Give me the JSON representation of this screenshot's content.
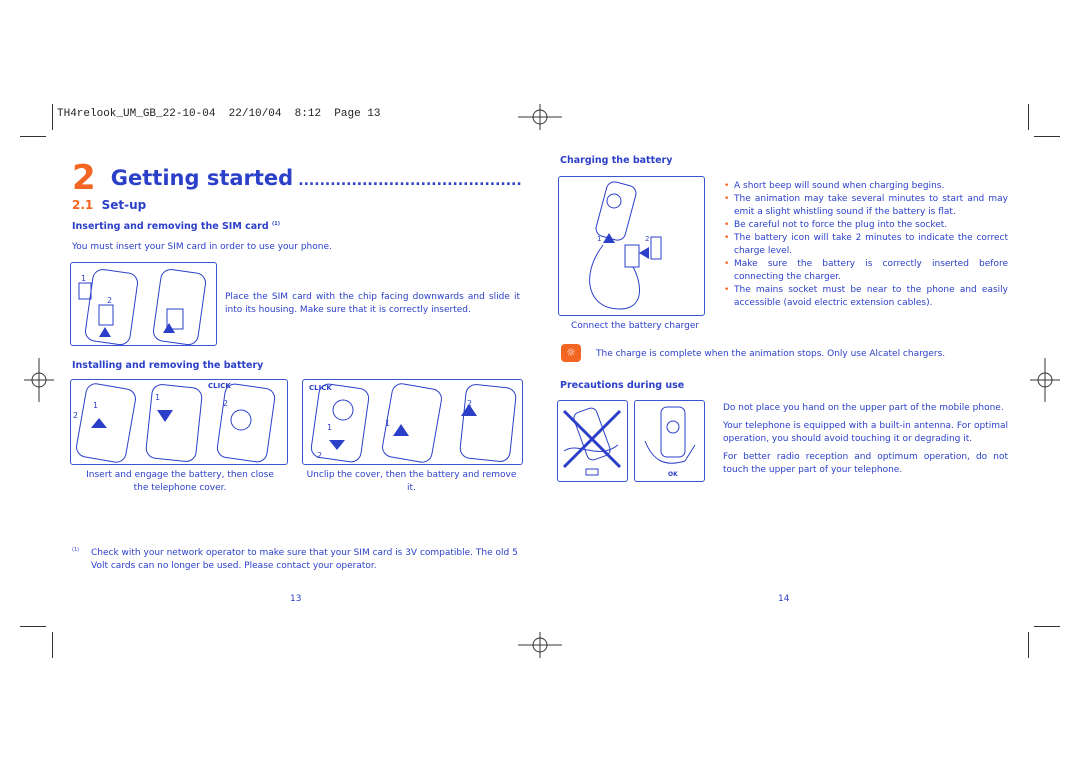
{
  "header": {
    "slug": "TH4relook_UM_GB_22-10-04",
    "date": "22/10/04",
    "time": "8:12",
    "page_label": "Page 13"
  },
  "left": {
    "chapter_number": "2",
    "chapter_title": "Getting started",
    "chapter_leader": "..........................................",
    "section_number": "2.1",
    "section_title": "Set-up",
    "sim_heading": "Inserting and removing the SIM card",
    "sim_footnote_mark": "(1)",
    "sim_intro": "You must insert your SIM card in order to use your phone.",
    "sim_caption": "Place the SIM card with the chip facing downwards and slide it into its housing. Make sure that it is correctly inserted.",
    "battery_heading": "Installing and removing the battery",
    "click_label": "CLICK",
    "insert_caption": "Insert and engage the battery, then close the telephone cover.",
    "unclip_caption": "Unclip the cover, then the battery and remove it.",
    "footnote_mark": "(1)",
    "footnote": "Check with your network operator to make sure that your SIM card is 3V compatible. The old 5 Volt cards can no longer be used. Please contact your operator.",
    "page_number": "13"
  },
  "right": {
    "charging_heading": "Charging the battery",
    "charger_caption": "Connect the battery charger",
    "bullets": [
      "A short beep will sound when charging begins.",
      "The animation may take several minutes to start and may emit a slight whistling sound if the battery is flat.",
      "Be careful not to force the plug into the socket.",
      "The battery icon will take 2 minutes to indicate the correct charge level.",
      "Make sure the battery is correctly inserted before connecting the charger.",
      "The mains socket must be near to the phone and easily accessible (avoid electric extension cables)."
    ],
    "tip": "The charge is complete when the animation stops. Only use Alcatel chargers.",
    "precautions_heading": "Precautions during use",
    "ok_label": "OK",
    "precautions": [
      "Do not place you hand on the upper part of the mobile phone.",
      "Your telephone is equipped with a built-in antenna. For optimal operation, you should avoid touching it or degrading it.",
      "For better radio reception and optimum operation, do not touch the upper part of your telephone."
    ],
    "page_number": "14"
  },
  "colors": {
    "text": "#2b3fc8",
    "accent": "#f26522"
  }
}
